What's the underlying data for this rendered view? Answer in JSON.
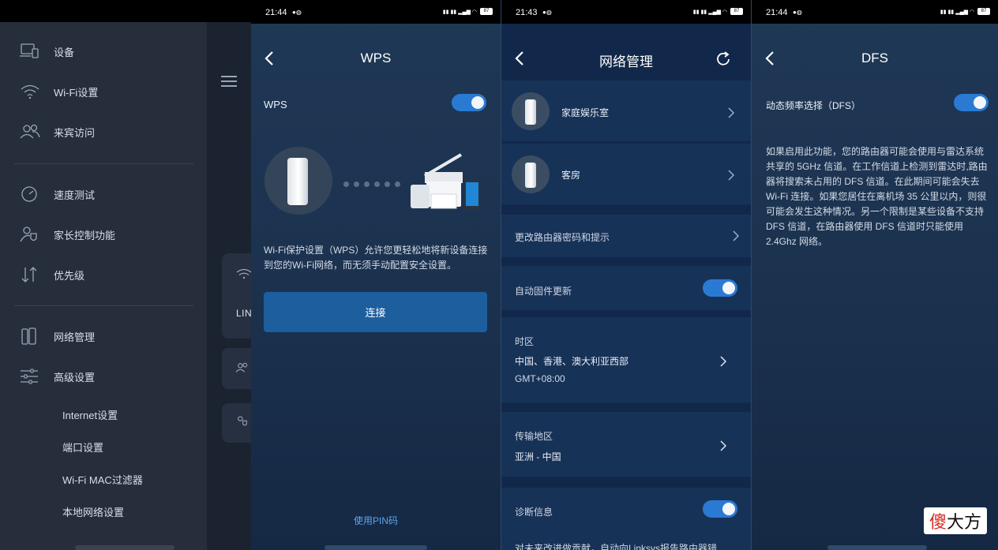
{
  "sidebar": {
    "items": [
      {
        "label": "设备",
        "icon": "devices-icon"
      },
      {
        "label": "Wi-Fi设置",
        "icon": "wifi-icon"
      },
      {
        "label": "来宾访问",
        "icon": "guests-icon"
      },
      {
        "label": "速度测试",
        "icon": "speedometer-icon"
      },
      {
        "label": "家长控制功能",
        "icon": "parental-control-icon"
      },
      {
        "label": "优先级",
        "icon": "priority-arrows-icon"
      },
      {
        "label": "网络管理",
        "icon": "network-admin-icon"
      },
      {
        "label": "高级设置",
        "icon": "sliders-icon"
      }
    ],
    "subitems": [
      "Internet设置",
      "端口设置",
      "Wi-Fi MAC过滤器",
      "本地网络设置"
    ],
    "peek_text": "LIN"
  },
  "wps_screen": {
    "status_time": "21:44",
    "battery": "87",
    "title": "WPS",
    "toggle_label": "WPS",
    "toggle_on": true,
    "description": "Wi-Fi保护设置（WPS）允许您更轻松地将新设备连接到您的Wi-Fi网络，而无须手动配置安全设置。",
    "connect_button": "连接",
    "pin_link": "使用PIN码"
  },
  "network_screen": {
    "status_time": "21:43",
    "battery": "87",
    "title": "网络管理",
    "rooms": [
      "家庭娱乐室",
      "客房"
    ],
    "change_password": "更改路由器密码和提示",
    "auto_update_label": "自动固件更新",
    "auto_update_on": true,
    "timezone_label": "时区",
    "timezone_value": "中国、香港、澳大利亚西部",
    "timezone_offset": "GMT+08:00",
    "region_label": "传输地区",
    "region_value": "亚洲 - 中国",
    "diagnostics_label": "诊断信息",
    "diagnostics_on": true,
    "diagnostics_desc": "对未来改进做贡献，自动向Linksys报告路由器错"
  },
  "dfs_screen": {
    "status_time": "21:44",
    "battery": "87",
    "title": "DFS",
    "toggle_label": "动态频率选择（DFS）",
    "toggle_on": true,
    "description": "如果启用此功能，您的路由器可能会使用与雷达系统共享的 5GHz 信道。在工作信道上检测到雷达时,路由器将搜索未占用的 DFS 信道。在此期间可能会失去 Wi-Fi 连接。如果您居住在离机场 35 公里以内，则很可能会发生这种情况。另一个限制是某些设备不支持 DFS 信道，在路由器使用 DFS 信道时只能使用 2.4Ghz 网络。"
  },
  "watermark": {
    "red": "傻",
    "black": "大方"
  },
  "colors": {
    "accent": "#2a7ad4",
    "button": "#1d5e9e",
    "link": "#5aa7ee"
  }
}
